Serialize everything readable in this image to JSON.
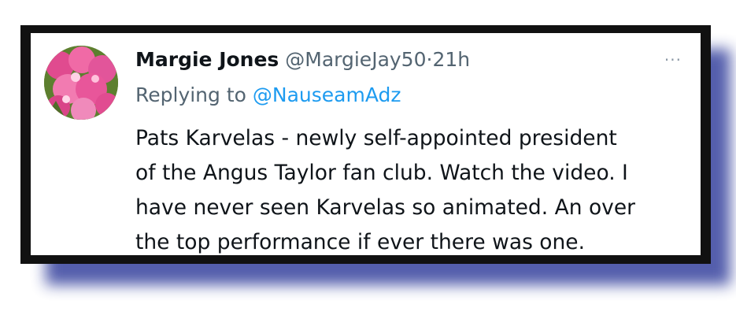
{
  "tweet": {
    "author_name": "Margie Jones",
    "handle": "@MargieJay50",
    "separator": "·",
    "time": "21h",
    "more_label": "···",
    "reply_prefix": "Replying to",
    "reply_to": "@NauseamAdz",
    "body_lines": [
      "Pats Karvelas - newly self-appointed president",
      "of the Angus Taylor fan club. Watch the video. I",
      "have never seen Karvelas so animated. An over",
      "the top performance if ever there was one."
    ]
  },
  "icons": {
    "avatar": "pink-flower-photo",
    "more": "more-options-icon"
  },
  "colors": {
    "link": "#1d9bf0",
    "secondary_text": "#536471",
    "primary_text": "#0f1419",
    "frame": "#111111",
    "shadow": "#4b56a8",
    "avatar_flower": "#e8569a"
  }
}
